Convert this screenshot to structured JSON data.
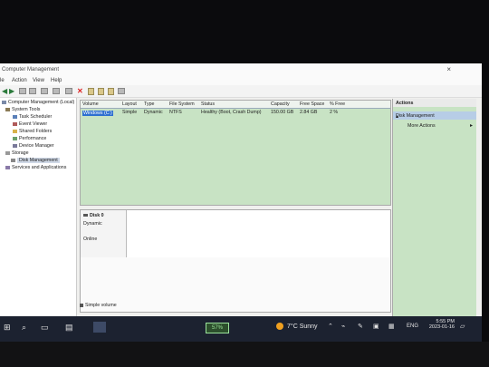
{
  "window": {
    "title": "Computer Management",
    "close": "×"
  },
  "menu": {
    "file": "le",
    "action": "Action",
    "view": "View",
    "help": "Help"
  },
  "tree": {
    "root": "Computer Management (Local)",
    "system_tools": "System Tools",
    "task_scheduler": "Task Scheduler",
    "event_viewer": "Event Viewer",
    "shared_folders": "Shared Folders",
    "performance": "Performance",
    "device_manager": "Device Manager",
    "storage": "Storage",
    "disk_management": "Disk Management",
    "services": "Services and Applications"
  },
  "volumes": {
    "headers": [
      "Volume",
      "Layout",
      "Type",
      "File System",
      "Status",
      "Capacity",
      "Free Space",
      "% Free"
    ],
    "rows": [
      [
        "Windows (C:)",
        "Simple",
        "Dynamic",
        "NTFS",
        "Healthy (Boot, Crash Dump)",
        "150.00 GB",
        "2.84 GB",
        "2 %"
      ]
    ]
  },
  "disk": {
    "name": "Disk 0",
    "type": "Dynamic",
    "status": "Online"
  },
  "legend": {
    "simple": "Simple volume"
  },
  "actions": {
    "header": "Actions",
    "section": "Disk Management",
    "more": "More Actions"
  },
  "taskbar": {
    "battery": "57%",
    "weather": "7°C  Sunny",
    "lang": "ENG",
    "time": "5:55 PM",
    "date": "2023-01-16"
  },
  "colors": {
    "accent": "#2e6fd0",
    "pane_green": "#c8e3c4",
    "taskbar": "#1c2230"
  }
}
